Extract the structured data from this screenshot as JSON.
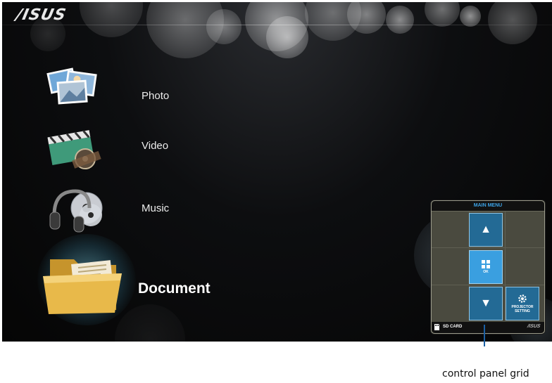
{
  "brand": {
    "logo_text": "/ISUS"
  },
  "menu": {
    "items": [
      {
        "label": "Photo",
        "icon": "photo-stack-icon",
        "active": false
      },
      {
        "label": "Video",
        "icon": "clapperboard-film-icon",
        "active": false
      },
      {
        "label": "Music",
        "icon": "headphones-cd-icon",
        "active": false
      },
      {
        "label": "Document",
        "icon": "folder-icon",
        "active": true
      }
    ]
  },
  "control_panel": {
    "title": "MAIN MENU",
    "up_glyph": "▲",
    "ok_label": "OK",
    "down_glyph": "▼",
    "projector_label_1": "PROJECTOR",
    "projector_label_2": "SETTING",
    "footer_source": "SD CARD",
    "footer_logo": "/ISUS"
  },
  "callout": {
    "text": "control panel grid"
  },
  "colors": {
    "background": "#050505",
    "panel_bg": "#4a4a3f",
    "button_blue": "#236a95",
    "ok_blue": "#3a9fe0",
    "header_text": "#3da3e6",
    "callout_line": "#1a5fa3"
  }
}
